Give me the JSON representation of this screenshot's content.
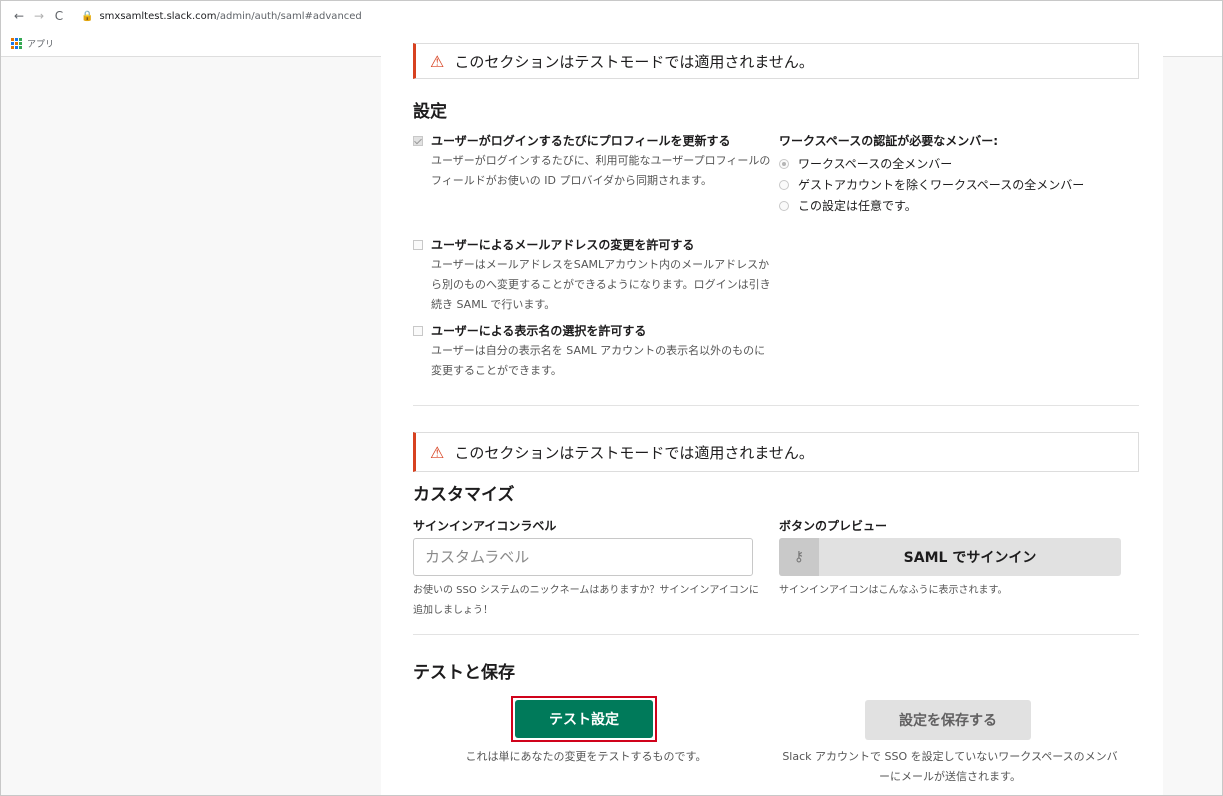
{
  "browser": {
    "url_host": "smxsamltest.slack.com",
    "url_path": "/admin/auth/saml#advanced",
    "bookmark_apps": "アプリ"
  },
  "warning_text": "このセクションはテストモードでは適用されません。",
  "settings": {
    "heading": "設定",
    "options": [
      {
        "title": "ユーザーがログインするたびにプロフィールを更新する",
        "desc": "ユーザーがログインするたびに、利用可能なユーザープロフィールのフィールドがお使いの ID プロバイダから同期されます。",
        "checked": true
      },
      {
        "title": "ユーザーによるメールアドレスの変更を許可する",
        "desc": "ユーザーはメールアドレスをSAMLアカウント内のメールアドレスから別のものへ変更することができるようになります。ログインは引き続き SAML で行います。",
        "checked": false
      },
      {
        "title": "ユーザーによる表示名の選択を許可する",
        "desc": "ユーザーは自分の表示名を SAML アカウントの表示名以外のものに変更することができます。",
        "checked": false
      }
    ],
    "members_heading": "ワークスペースの認証が必要なメンバー:",
    "members_options": [
      {
        "label": "ワークスペースの全メンバー",
        "selected": true
      },
      {
        "label": "ゲストアカウントを除くワークスペースの全メンバー",
        "selected": false
      },
      {
        "label": "この設定は任意です。",
        "selected": false
      }
    ]
  },
  "customize": {
    "heading": "カスタマイズ",
    "icon_label_heading": "サインインアイコンラベル",
    "icon_label_placeholder": "カスタムラベル",
    "icon_label_hint": "お使いの SSO システムのニックネームはありますか？サインインアイコンに追加しましょう！",
    "preview_heading": "ボタンのプレビュー",
    "preview_button": "SAML でサインイン",
    "preview_hint": "サインインアイコンはこんなふうに表示されます。"
  },
  "test_save": {
    "heading": "テストと保存",
    "test_button": "テスト設定",
    "test_hint": "これは単にあなたの変更をテストするものです。",
    "save_button": "設定を保存する",
    "save_hint": "Slack アカウントで SSO を設定していないワークスペースのメンバーにメールが送信されます。"
  },
  "colors": {
    "warning_accent": "#d74120",
    "primary_button": "#007a5a",
    "highlight_border": "#d0021b"
  }
}
